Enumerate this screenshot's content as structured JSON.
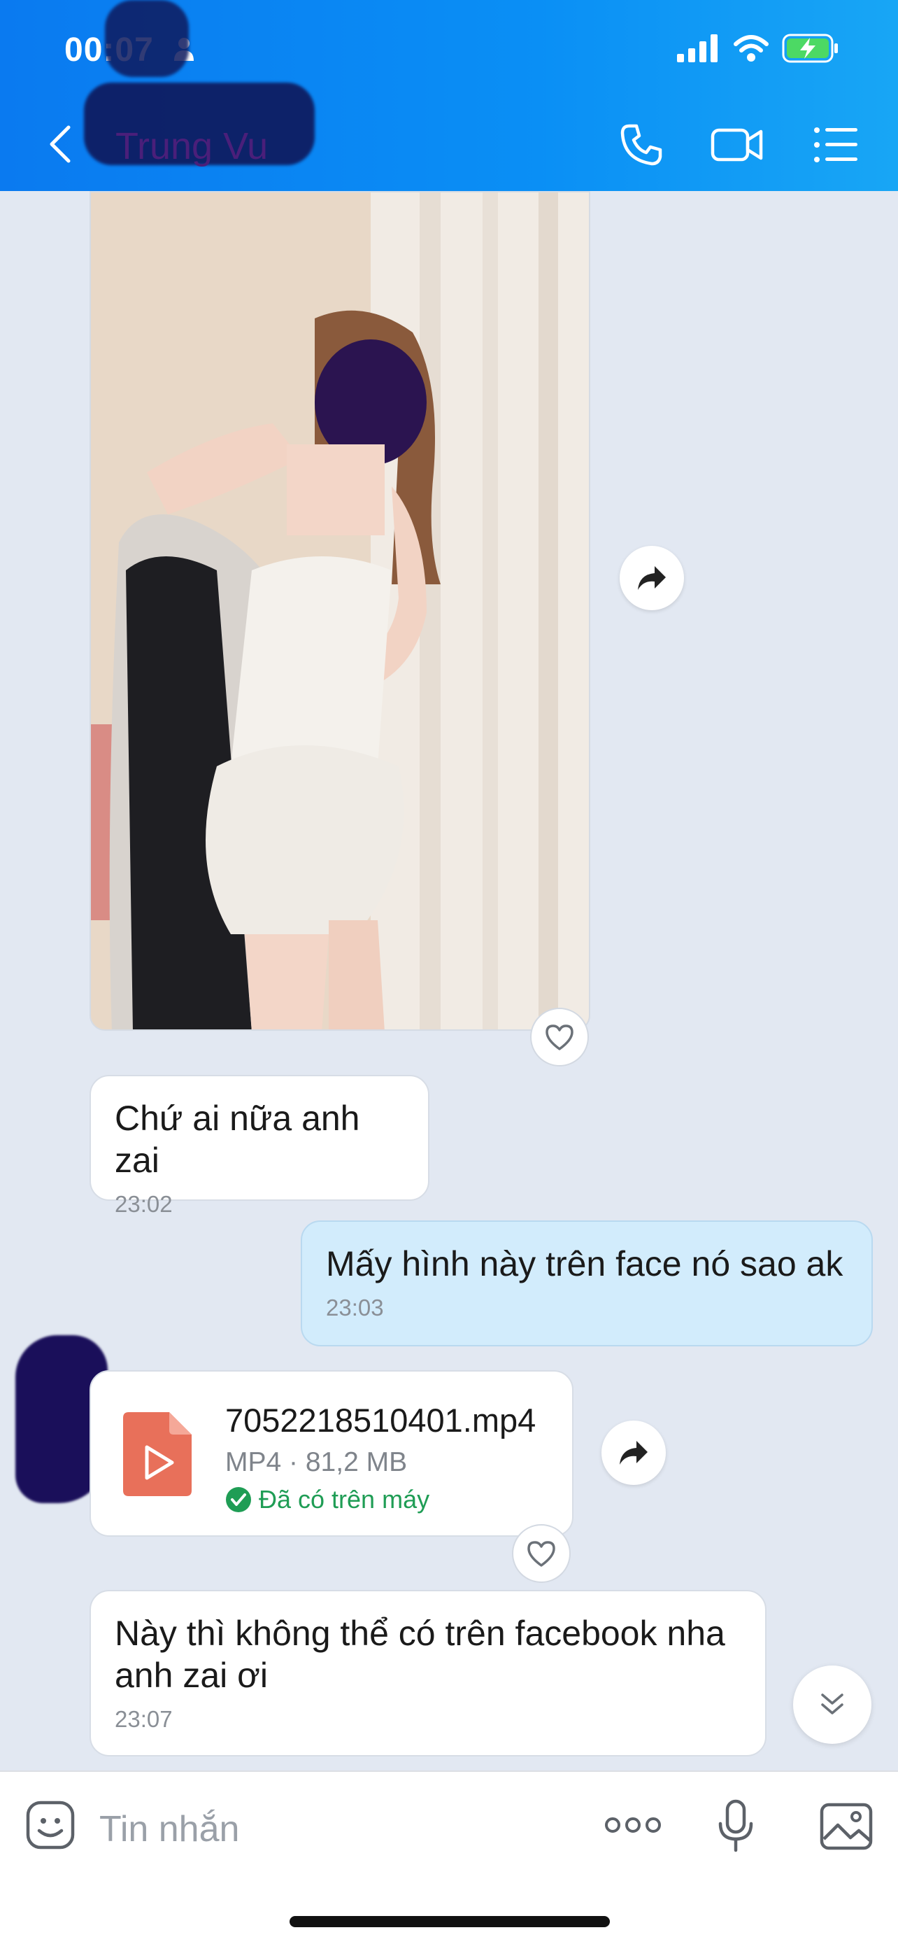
{
  "status_bar": {
    "time": "00:07"
  },
  "header": {
    "contact_name": "Trung Vu",
    "back_icon": "chevron-left-icon",
    "call_icon": "phone-icon",
    "video_icon": "video-camera-icon",
    "menu_icon": "list-menu-icon"
  },
  "messages": [
    {
      "type": "image",
      "direction": "incoming"
    },
    {
      "type": "text",
      "direction": "incoming",
      "text": "Chứ ai nữa anh zai",
      "time": "23:02"
    },
    {
      "type": "text",
      "direction": "outgoing",
      "text": "Mấy hình này trên face nó sao ak",
      "time": "23:03"
    },
    {
      "type": "file",
      "direction": "incoming",
      "file_name": "7052218510401.mp4",
      "file_meta": "MP4 · 81,2 MB",
      "file_status": "Đã có trên máy"
    },
    {
      "type": "text",
      "direction": "incoming",
      "text": "Này thì không thể có trên facebook nha anh zai ơi",
      "time": "23:07"
    }
  ],
  "composer": {
    "placeholder": "Tin nhắn",
    "emoji_icon": "sticker-icon",
    "more_icon": "more-dots-icon",
    "mic_icon": "microphone-icon",
    "gallery_icon": "image-gallery-icon"
  },
  "colors": {
    "header_blue": "#0a8ff5",
    "outgoing_bubble": "#d2ecfc",
    "incoming_bubble": "#ffffff",
    "chat_background": "#e2e8f2",
    "downloaded_green": "#1f9d55",
    "video_file_orange": "#e8705a"
  }
}
